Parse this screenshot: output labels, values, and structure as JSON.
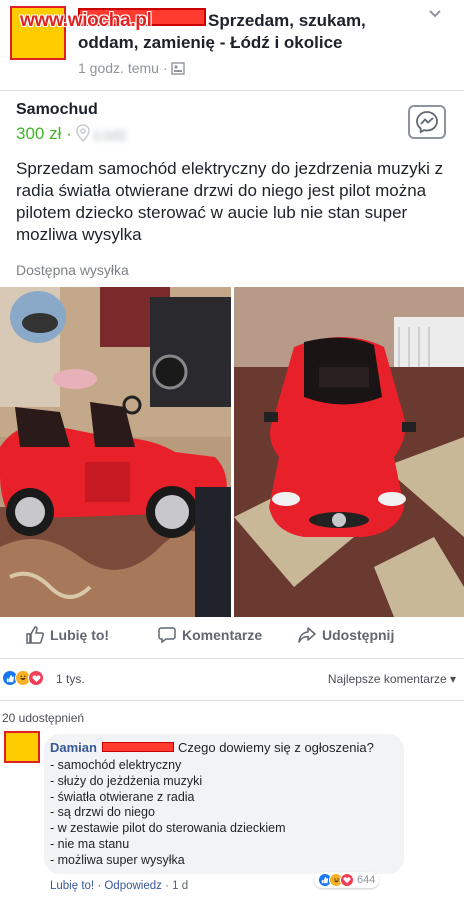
{
  "watermark": "www.wiocha.pl",
  "group": {
    "title": "Sprzedam, szukam, oddam, zamienię - Łódź i okolice",
    "time": "1 godz. temu ·"
  },
  "listing": {
    "title": "Samochud",
    "price": "300 zł ·",
    "location": "Łódź",
    "description": "Sprzedam samochód elektryczny do jezdrzenia muzyki z radia światła otwierane drzwi do niego jest pilot można pilotem dziecko sterować w aucie  lub nie stan  super mozliwa wysylka",
    "shipping": "Dostępna wysyłka"
  },
  "actions": {
    "like": "Lubię to!",
    "comment": "Komentarze",
    "share": "Udostępnij"
  },
  "reactions": {
    "count": "1 tys.",
    "best_comments": "Najlepsze komentarze ▾",
    "shares": "20 udostępnień"
  },
  "comment": {
    "author": "Damian",
    "question": "Czego dowiemy się z ogłoszenia?",
    "lines": [
      "- samochód elektryczny",
      "- służy do jeżdżenia muzyki",
      "- światła otwierane z radia",
      "- są drzwi do niego",
      "- w zestawie pilot do sterowania dzieckiem",
      "- nie ma stanu",
      "- możliwa super wysyłka"
    ],
    "like": "Lubię to!",
    "reply": "Odpowiedz",
    "time": "· 1 d",
    "reaction_count": "644"
  },
  "colors": {
    "price_green": "#42b72a",
    "link_blue": "#385898",
    "car_red": "#e8202a",
    "like_blue": "#1877f2",
    "love_red": "#f33e58",
    "haha_yellow": "#f7b125"
  },
  "icons": {
    "chevron": "chevron-down-icon",
    "location": "location-pin-icon",
    "globe": "audience-icon",
    "messenger": "messenger-icon",
    "like": "thumbs-up-icon",
    "comment": "comment-bubble-icon",
    "share": "share-arrow-icon"
  }
}
